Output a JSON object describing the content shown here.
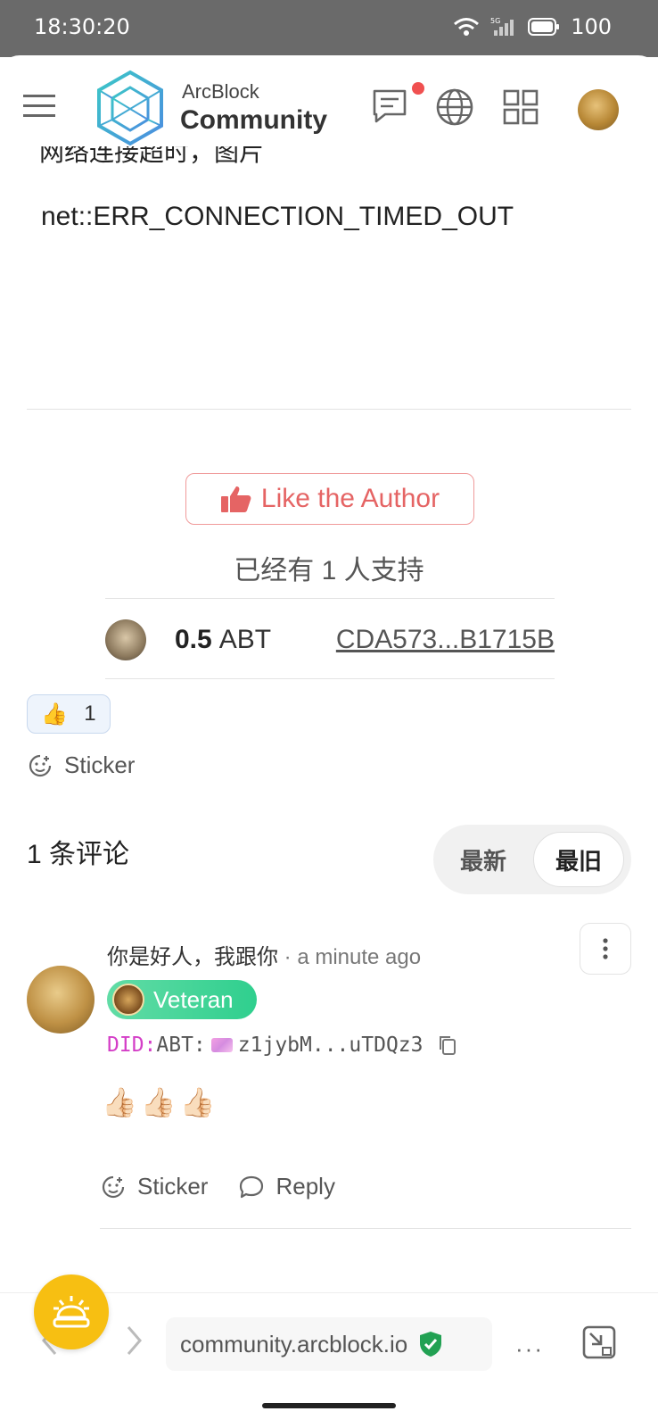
{
  "status": {
    "time": "18:30:20",
    "battery": "100",
    "network": "5G"
  },
  "header": {
    "brand_line1": "ArcBlock",
    "brand_line2": "Community",
    "icons": [
      "menu-icon",
      "chat-icon",
      "globe-icon",
      "apps-grid-icon",
      "avatar"
    ]
  },
  "post": {
    "partial_text": "网络连接超时，图片",
    "error_text": "net::ERR_CONNECTION_TIMED_OUT"
  },
  "like": {
    "button_label": "Like the Author",
    "supporters_text": "已经有 1 人支持",
    "tip": {
      "amount": "0.5",
      "unit": "ABT",
      "address": "CDA573...B1715B"
    }
  },
  "reactions": {
    "emoji": "👍",
    "count": "1"
  },
  "sticker_label": "Sticker",
  "comments": {
    "count_label": "1 条评论",
    "sort": {
      "newest": "最新",
      "oldest": "最旧",
      "selected": "oldest"
    },
    "items": [
      {
        "author": "你是好人，我跟你",
        "time": "· a minute ago",
        "badge": "Veteran",
        "did_prefix": "DID:",
        "did_chain": "ABT:",
        "did_value": "z1jybM...uTDQz3",
        "body": "👍🏻👍🏻👍🏻",
        "actions": {
          "sticker": "Sticker",
          "reply": "Reply"
        }
      }
    ]
  },
  "browser": {
    "url": "community.arcblock.io",
    "more": "···"
  },
  "colors": {
    "accent_red": "#e56464",
    "badge_green": "#2fcf8e",
    "fab_yellow": "#f7bf12",
    "did_pink": "#d43ec7"
  }
}
